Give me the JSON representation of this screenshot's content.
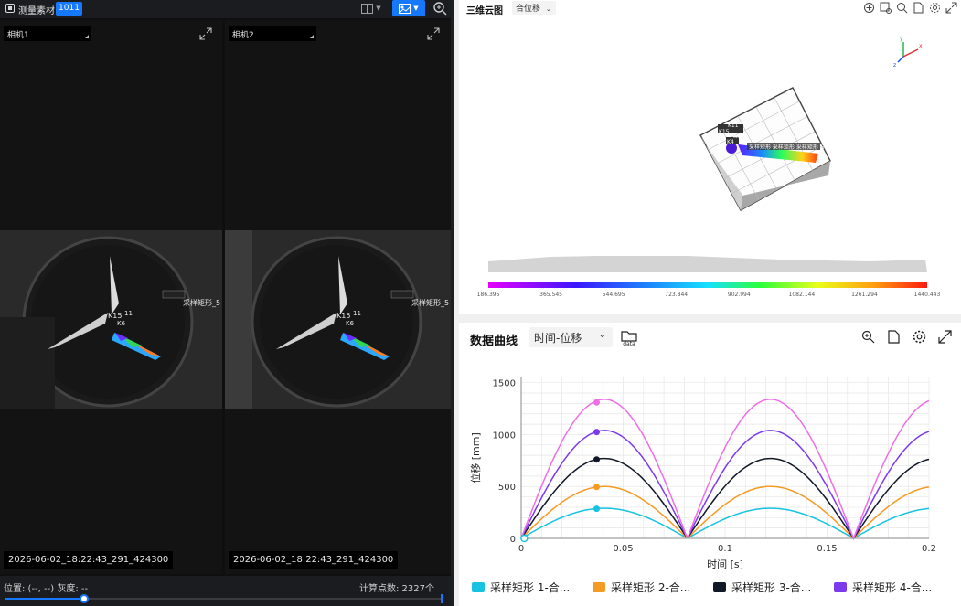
{
  "topbar": {
    "title": "测量素材",
    "badge": "1011"
  },
  "cameras": [
    {
      "label": "相机1",
      "timestamp": "2026-06-02_18:22:43_291_424300",
      "overlay_labels": [
        "K15",
        "11",
        "K6",
        "采样矩形_5"
      ]
    },
    {
      "label": "相机2",
      "timestamp": "2026-06-02_18:22:43_291_424300",
      "overlay_labels": [
        "K15",
        "11",
        "K6",
        "采样矩形_5"
      ]
    }
  ],
  "status": {
    "position": "位置: (--, --) 灰度: --",
    "count": "计算点数:  2327个",
    "slider_progress": 0.18
  },
  "panel3d": {
    "title": "三维云图",
    "mode": "合位移",
    "colorbar_ticks": [
      "186.395",
      "365.545",
      "544.695",
      "723.844",
      "902.994",
      "1082.144",
      "1261.294",
      "1440.443"
    ],
    "scene_labels": [
      "K11",
      "K15",
      "K6",
      "K4",
      "采样矩形 采样矩形 采样矩形_5"
    ],
    "axis_labels": [
      "y",
      "x",
      "z"
    ]
  },
  "chart_panel": {
    "title": "数据曲线",
    "mode": "时间-位移",
    "data_icon_label": "data"
  },
  "chart_data": {
    "type": "line",
    "xlabel": "时间 [s]",
    "ylabel": "位移 [mm]",
    "xlim": [
      0,
      0.2
    ],
    "ylim": [
      0,
      1550
    ],
    "xticks": [
      "0",
      "0.05",
      "0.1",
      "0.15",
      "0.2"
    ],
    "yticks": [
      "0",
      "500",
      "1000",
      "1500"
    ],
    "grid": true,
    "legend_position": "bottom",
    "x": [
      0,
      0.01,
      0.02,
      0.03,
      0.04,
      0.05,
      0.06,
      0.07,
      0.08,
      0.09,
      0.1,
      0.11,
      0.12,
      0.13,
      0.14,
      0.15,
      0.16,
      0.17,
      0.18,
      0.19,
      0.2
    ],
    "series": [
      {
        "name": "采样矩形 1-合...",
        "color": "#17c3e0",
        "peak": 290,
        "marker_x": 0.037,
        "marker_y": 285
      },
      {
        "name": "采样矩形 2-合...",
        "color": "#f59a23",
        "peak": 500,
        "marker_x": 0.037,
        "marker_y": 495
      },
      {
        "name": "采样矩形 3-合...",
        "color": "#111827",
        "peak": 770,
        "marker_x": 0.037,
        "marker_y": 760
      },
      {
        "name": "采样矩形 4-合...",
        "color": "#7c3aed",
        "peak": 1040,
        "marker_x": 0.037,
        "marker_y": 1025
      },
      {
        "name": "",
        "color": "#ee6ee8",
        "peak": 1340,
        "marker_x": 0.037,
        "marker_y": 1310
      }
    ],
    "period": 0.0815
  }
}
